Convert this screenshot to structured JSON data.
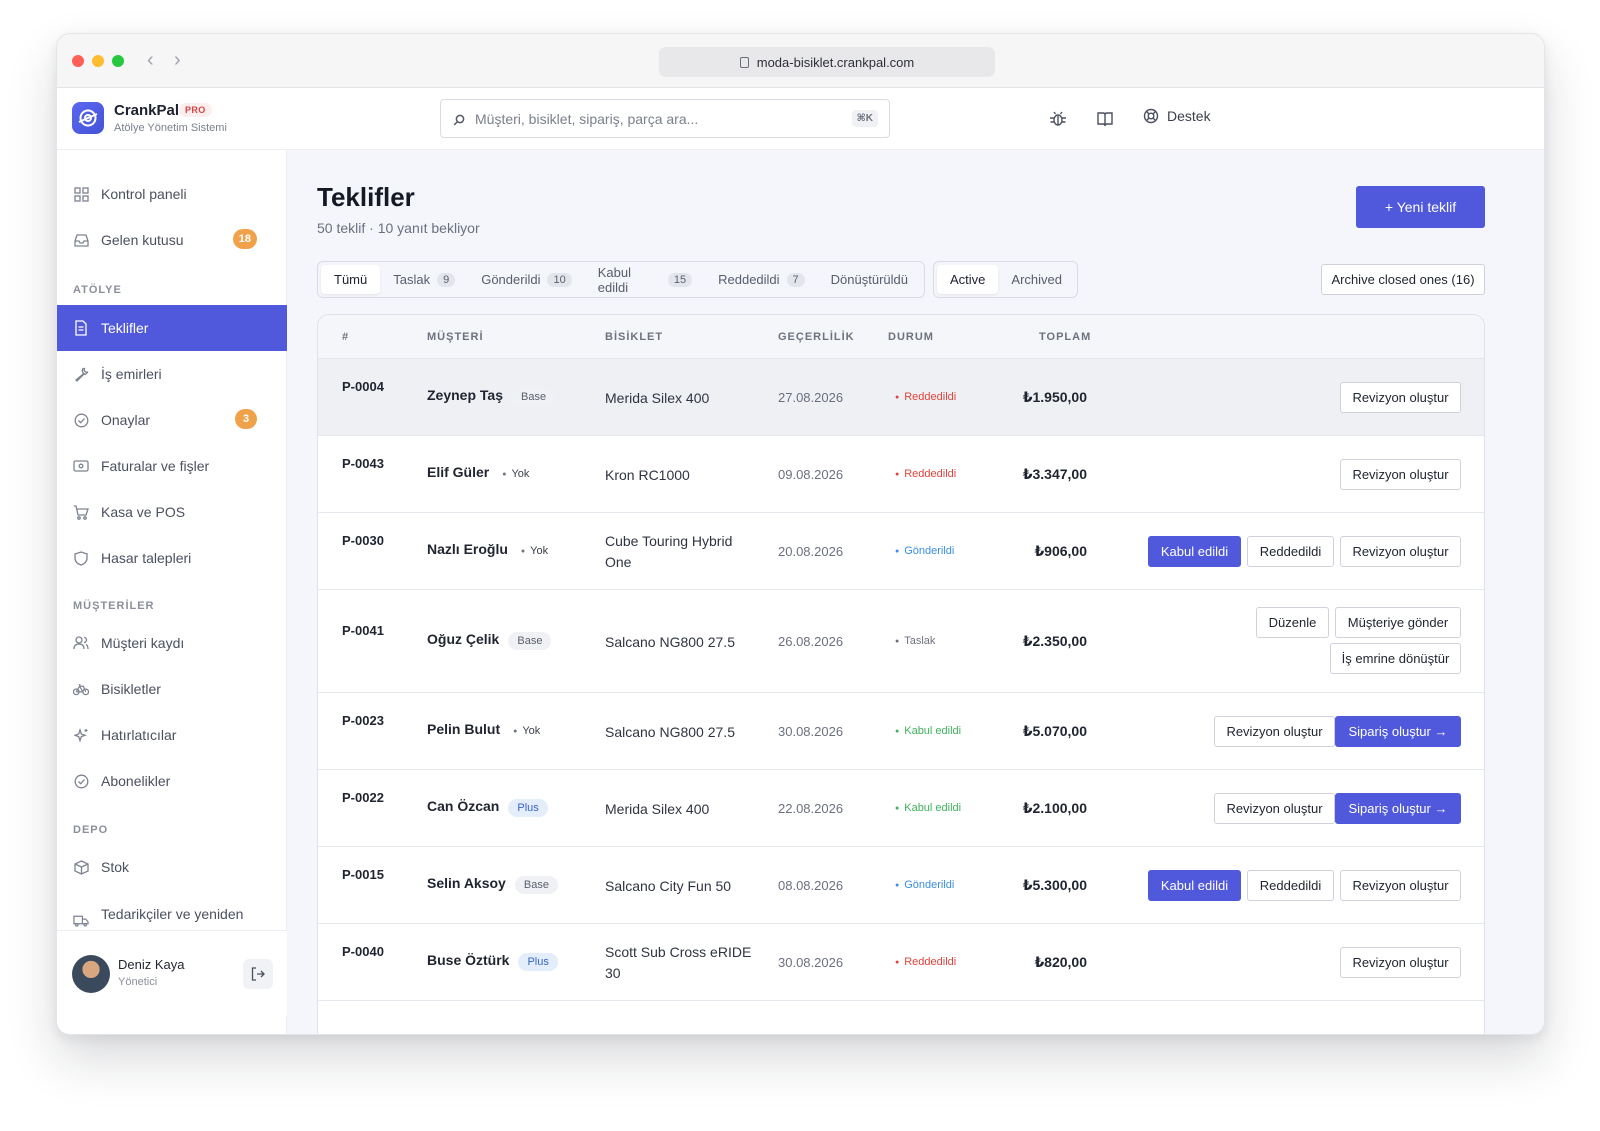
{
  "browser": {
    "url": "moda-bisiklet.crankpal.com"
  },
  "brand": {
    "name": "CrankPal",
    "badge": "PRO",
    "subtitle": "Atölye Yönetim Sistemi"
  },
  "search": {
    "placeholder": "Müşteri, bisiklet, sipariş, parça ara...",
    "shortcut": "⌘K"
  },
  "topbar": {
    "support_label": "Destek"
  },
  "sidebar": {
    "top_items": [
      {
        "label": "Kontrol paneli"
      },
      {
        "label": "Gelen kutusu",
        "badge": "18"
      }
    ],
    "sections": [
      {
        "label": "ATÖLYE",
        "items": [
          {
            "label": "Teklifler",
            "active": true
          },
          {
            "label": "İş emirleri"
          },
          {
            "label": "Onaylar",
            "badge": "3"
          },
          {
            "label": "Faturalar ve fişler"
          },
          {
            "label": "Kasa ve POS"
          },
          {
            "label": "Hasar talepleri"
          }
        ]
      },
      {
        "label": "MÜŞTERİLER",
        "items": [
          {
            "label": "Müşteri kaydı"
          },
          {
            "label": "Bisikletler"
          },
          {
            "label": "Hatırlatıcılar"
          },
          {
            "label": "Abonelikler"
          }
        ]
      },
      {
        "label": "DEPO",
        "items": [
          {
            "label": "Stok"
          },
          {
            "label": "Tedarikçiler ve yeniden"
          }
        ]
      }
    ],
    "user": {
      "name": "Deniz Kaya",
      "role": "Yönetici"
    }
  },
  "page": {
    "title": "Teklifler",
    "subtitle": "50 teklif · 10 yanıt bekliyor",
    "new_button": "+ Yeni teklif",
    "archive_button": "Archive closed ones (16)",
    "status_tabs": [
      {
        "label": "Tümü",
        "count": ""
      },
      {
        "label": "Taslak",
        "count": "9"
      },
      {
        "label": "Gönderildi",
        "count": "10"
      },
      {
        "label": "Kabul edildi",
        "count": "15"
      },
      {
        "label": "Reddedildi",
        "count": "7"
      },
      {
        "label": "Dönüştürüldü",
        "count": ""
      }
    ],
    "view_tabs": [
      "Active",
      "Archived"
    ]
  },
  "table": {
    "headers": [
      "#",
      "MÜŞTERİ",
      "BİSİKLET",
      "GEÇERLİLİK",
      "DURUM",
      "TOPLAM"
    ],
    "rows": [
      {
        "id": "P-0004",
        "customer": "Zeynep Taş",
        "tier": "Base",
        "bike": "Merida Silex 400",
        "valid": "27.08.2026",
        "status": "Reddedildi",
        "total": "₺1.950,00",
        "actions": [
          "Revizyon oluştur"
        ]
      },
      {
        "id": "P-0043",
        "customer": "Elif Güler",
        "tier": "Yok",
        "bike": "Kron RC1000",
        "valid": "09.08.2026",
        "status": "Reddedildi",
        "total": "₺3.347,00",
        "actions": [
          "Revizyon oluştur"
        ]
      },
      {
        "id": "P-0030",
        "customer": "Nazlı Eroğlu",
        "tier": "Yok",
        "bike": "Cube Touring Hybrid One",
        "valid": "20.08.2026",
        "status": "Gönderildi",
        "total": "₺906,00",
        "actions": [
          "Kabul edildi",
          "Reddedildi",
          "Revizyon oluştur"
        ]
      },
      {
        "id": "P-0041",
        "customer": "Oğuz Çelik",
        "tier": "Base",
        "bike": "Salcano NG800 27.5",
        "valid": "26.08.2026",
        "status": "Taslak",
        "total": "₺2.350,00",
        "actions": [
          "Düzenle",
          "Müşteriye gönder",
          "İş emrine dönüştür"
        ]
      },
      {
        "id": "P-0023",
        "customer": "Pelin Bulut",
        "tier": "Yok",
        "bike": "Salcano NG800 27.5",
        "valid": "30.08.2026",
        "status": "Kabul edildi",
        "total": "₺5.070,00",
        "actions": [
          "Revizyon oluştur",
          "Sipariş oluştur →"
        ]
      },
      {
        "id": "P-0022",
        "customer": "Can Özcan",
        "tier": "Plus",
        "bike": "Merida Silex 400",
        "valid": "22.08.2026",
        "status": "Kabul edildi",
        "total": "₺2.100,00",
        "actions": [
          "Revizyon oluştur",
          "Sipariş oluştur →"
        ]
      },
      {
        "id": "P-0015",
        "customer": "Selin Aksoy",
        "tier": "Base",
        "bike": "Salcano City Fun 50",
        "valid": "08.08.2026",
        "status": "Gönderildi",
        "total": "₺5.300,00",
        "actions": [
          "Kabul edildi",
          "Reddedildi",
          "Revizyon oluştur"
        ]
      },
      {
        "id": "P-0040",
        "customer": "Buse Öztürk",
        "tier": "Plus",
        "bike": "Scott Sub Cross eRIDE 30",
        "valid": "30.08.2026",
        "status": "Reddedildi",
        "total": "₺820,00",
        "actions": [
          "Revizyon oluştur"
        ]
      }
    ]
  },
  "colors": {
    "accent": "#5058dc",
    "badge": "#f0a24a",
    "rejected": "#e0443c",
    "sent": "#3b8ee0",
    "accepted": "#3fb15c",
    "draft": "#6d7280"
  }
}
